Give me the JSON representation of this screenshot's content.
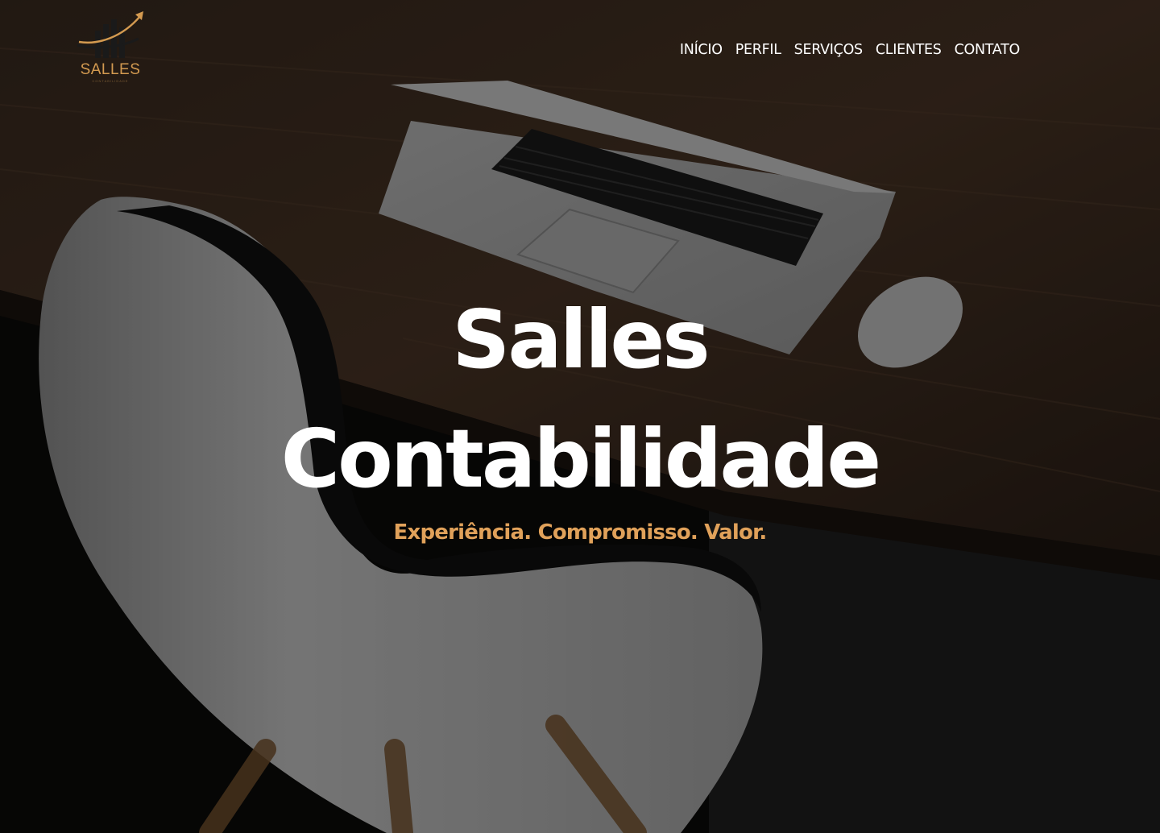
{
  "brand": {
    "logo_text": "SALLES",
    "logo_subtext": "CONTABILIDADE",
    "accent_color": "#e0a15a"
  },
  "nav": {
    "items": [
      {
        "label": "INÍCIO"
      },
      {
        "label": "PERFIL"
      },
      {
        "label": "SERVIÇOS"
      },
      {
        "label": "CLIENTES"
      },
      {
        "label": "CONTATO"
      }
    ]
  },
  "hero": {
    "title_line1": "Salles",
    "title_line2": "Contabilidade",
    "tagline": "Experiência.  Compromisso.  Valor."
  }
}
